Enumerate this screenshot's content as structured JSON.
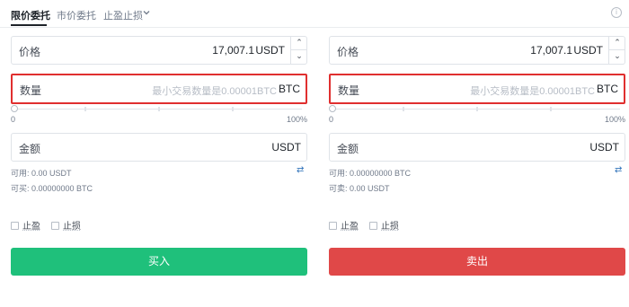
{
  "tabs": [
    {
      "label": "限价委托",
      "active": true
    },
    {
      "label": "市价委托",
      "active": false
    },
    {
      "label": "止盈止损",
      "active": false
    }
  ],
  "buy": {
    "price_label": "价格",
    "price_value": "17,007.1",
    "price_unit": "USDT",
    "qty_label": "数量",
    "qty_placeholder": "最小交易数量是0.00001BTC",
    "qty_unit": "BTC",
    "slider_min": "0",
    "slider_max": "100%",
    "amount_label": "金额",
    "amount_unit": "USDT",
    "available": "可用: 0.00 USDT",
    "can_trade": "可买: 0.00000000 BTC",
    "take_profit": "止盈",
    "stop_loss": "止损",
    "action_label": "买入"
  },
  "sell": {
    "price_label": "价格",
    "price_value": "17,007.1",
    "price_unit": "USDT",
    "qty_label": "数量",
    "qty_placeholder": "最小交易数量是0.00001BTC",
    "qty_unit": "BTC",
    "slider_min": "0",
    "slider_max": "100%",
    "amount_label": "金额",
    "amount_unit": "USDT",
    "available": "可用: 0.00000000 BTC",
    "can_trade": "可卖: 0.00 USDT",
    "take_profit": "止盈",
    "stop_loss": "止损",
    "action_label": "卖出"
  },
  "icons": {
    "stepper_up": "chevron-up-icon",
    "stepper_down": "chevron-down-icon",
    "swap": "swap-icon",
    "info": "info-icon"
  },
  "colors": {
    "buy": "#1fc07b",
    "sell": "#e04848",
    "highlight": "#e02f2f",
    "link": "#3375bb"
  }
}
